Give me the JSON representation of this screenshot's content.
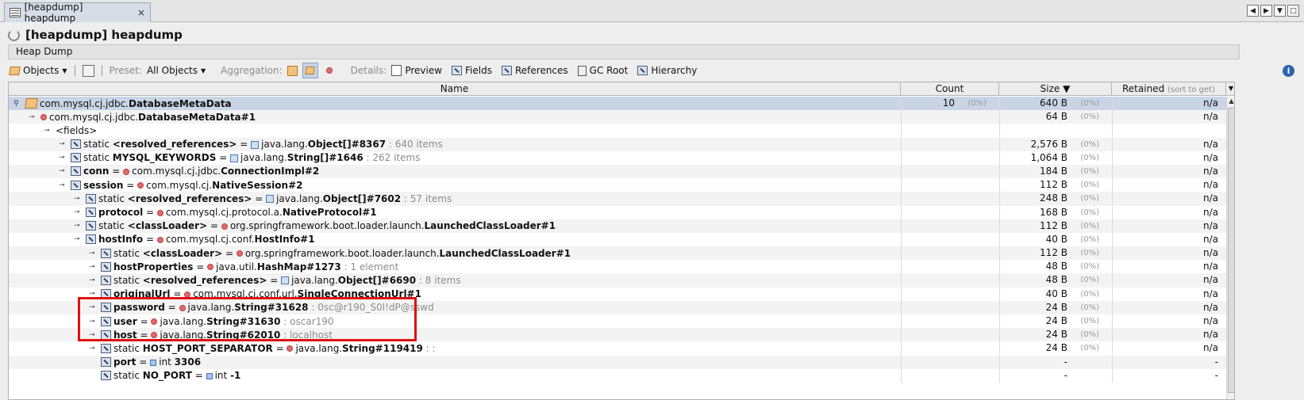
{
  "tab": {
    "label": "[heapdump] heapdump",
    "close": "×"
  },
  "window_buttons": [
    "◀",
    "▶",
    "▼",
    "□"
  ],
  "title": "[heapdump] heapdump",
  "section": "Heap Dump",
  "toolbar": {
    "objects": "Objects",
    "preset_label": "Preset:",
    "preset_value": "All Objects",
    "aggregation_label": "Aggregation:",
    "details_label": "Details:",
    "preview": "Preview",
    "fields": "Fields",
    "references": "References",
    "gc_root": "GC Root",
    "hierarchy": "Hierarchy"
  },
  "columns": {
    "name": "Name",
    "count": "Count",
    "size": "Size ▼",
    "retained": "Retained",
    "retained_note": "(sort to get)"
  },
  "rows": [
    {
      "depth": 0,
      "toggle": "⚲",
      "icon": "class",
      "static": "",
      "name": "",
      "eq": "",
      "pkg": "com.mysql.cj.jdbc.",
      "cls": "DatabaseMetaData",
      "suffix": "",
      "count": "10",
      "countpct": "(0%)",
      "size": "640 B",
      "sizepct": "(0%)",
      "ret": "n/a",
      "sel": true
    },
    {
      "depth": 1,
      "toggle": "⊸",
      "icon": "obj",
      "static": "",
      "name": "",
      "eq": "",
      "pkg": "com.mysql.cj.jdbc.",
      "cls": "DatabaseMetaData#1",
      "suffix": "",
      "count": "",
      "countpct": "",
      "size": "64 B",
      "sizepct": "(0%)",
      "ret": "n/a"
    },
    {
      "depth": 2,
      "toggle": "⊸",
      "icon": "none",
      "static": "",
      "name": "",
      "eq": "",
      "pkg": "<fields>",
      "cls": "",
      "suffix": "",
      "count": "",
      "countpct": "",
      "size": "",
      "sizepct": "",
      "ret": ""
    },
    {
      "depth": 3,
      "toggle": "⊸",
      "icon": "field",
      "static": "static ",
      "name": "<resolved_references>",
      "eq": " = ",
      "vicon": "arr",
      "pkg": "java.lang.",
      "cls": "Object[]#8367",
      "suffix": " : 640 items",
      "count": "",
      "countpct": "",
      "size": "2,576 B",
      "sizepct": "(0%)",
      "ret": "n/a"
    },
    {
      "depth": 3,
      "toggle": "⊸",
      "icon": "field",
      "static": "static ",
      "name": "MYSQL_KEYWORDS",
      "eq": " = ",
      "vicon": "arr",
      "pkg": "java.lang.",
      "cls": "String[]#1646",
      "suffix": " : 262 items",
      "count": "",
      "countpct": "",
      "size": "1,064 B",
      "sizepct": "(0%)",
      "ret": "n/a"
    },
    {
      "depth": 3,
      "toggle": "⊸",
      "icon": "field",
      "static": "",
      "name": "conn",
      "eq": " = ",
      "vicon": "obj",
      "pkg": "com.mysql.cj.jdbc.",
      "cls": "ConnectionImpl#2",
      "suffix": "",
      "count": "",
      "countpct": "",
      "size": "184 B",
      "sizepct": "(0%)",
      "ret": "n/a"
    },
    {
      "depth": 3,
      "toggle": "⊸",
      "icon": "field",
      "static": "",
      "name": "session",
      "eq": " = ",
      "vicon": "obj",
      "pkg": "com.mysql.cj.",
      "cls": "NativeSession#2",
      "suffix": "",
      "count": "",
      "countpct": "",
      "size": "112 B",
      "sizepct": "(0%)",
      "ret": "n/a"
    },
    {
      "depth": 4,
      "toggle": "⊸",
      "icon": "field",
      "static": "static ",
      "name": "<resolved_references>",
      "eq": " = ",
      "vicon": "arr",
      "pkg": "java.lang.",
      "cls": "Object[]#7602",
      "suffix": " : 57 items",
      "count": "",
      "countpct": "",
      "size": "248 B",
      "sizepct": "(0%)",
      "ret": "n/a"
    },
    {
      "depth": 4,
      "toggle": "⊸",
      "icon": "field",
      "static": "",
      "name": "protocol",
      "eq": " = ",
      "vicon": "obj",
      "pkg": "com.mysql.cj.protocol.a.",
      "cls": "NativeProtocol#1",
      "suffix": "",
      "count": "",
      "countpct": "",
      "size": "168 B",
      "sizepct": "(0%)",
      "ret": "n/a"
    },
    {
      "depth": 4,
      "toggle": "⊸",
      "icon": "field",
      "static": "static ",
      "name": "<classLoader>",
      "eq": " = ",
      "vicon": "obj",
      "pkg": "org.springframework.boot.loader.launch.",
      "cls": "LaunchedClassLoader#1",
      "suffix": "",
      "count": "",
      "countpct": "",
      "size": "112 B",
      "sizepct": "(0%)",
      "ret": "n/a"
    },
    {
      "depth": 4,
      "toggle": "⊸",
      "icon": "field",
      "static": "",
      "name": "hostInfo",
      "eq": " = ",
      "vicon": "obj",
      "pkg": "com.mysql.cj.conf.",
      "cls": "HostInfo#1",
      "suffix": "",
      "count": "",
      "countpct": "",
      "size": "40 B",
      "sizepct": "(0%)",
      "ret": "n/a"
    },
    {
      "depth": 5,
      "toggle": "⊸",
      "icon": "field",
      "static": "static ",
      "name": "<classLoader>",
      "eq": " = ",
      "vicon": "obj",
      "pkg": "org.springframework.boot.loader.launch.",
      "cls": "LaunchedClassLoader#1",
      "suffix": "",
      "count": "",
      "countpct": "",
      "size": "112 B",
      "sizepct": "(0%)",
      "ret": "n/a"
    },
    {
      "depth": 5,
      "toggle": "⊸",
      "icon": "field",
      "static": "",
      "name": "hostProperties",
      "eq": " = ",
      "vicon": "obj",
      "pkg": "java.util.",
      "cls": "HashMap#1273",
      "suffix": " : 1 element",
      "count": "",
      "countpct": "",
      "size": "48 B",
      "sizepct": "(0%)",
      "ret": "n/a"
    },
    {
      "depth": 5,
      "toggle": "⊸",
      "icon": "field",
      "static": "static ",
      "name": "<resolved_references>",
      "eq": " = ",
      "vicon": "arr",
      "pkg": "java.lang.",
      "cls": "Object[]#6690",
      "suffix": " : 8 items",
      "count": "",
      "countpct": "",
      "size": "48 B",
      "sizepct": "(0%)",
      "ret": "n/a"
    },
    {
      "depth": 5,
      "toggle": "⊸",
      "icon": "field",
      "static": "",
      "name": "originalUrl",
      "eq": " = ",
      "vicon": "obj",
      "pkg": "com.mysql.cj.conf.url.",
      "cls": "SingleConnectionUrl#1",
      "suffix": "",
      "count": "",
      "countpct": "",
      "size": "40 B",
      "sizepct": "(0%)",
      "ret": "n/a"
    },
    {
      "depth": 5,
      "toggle": "⊸",
      "icon": "field",
      "static": "",
      "name": "password",
      "eq": " = ",
      "vicon": "obj",
      "pkg": "java.lang.",
      "cls": "String#31628",
      "suffix": " : 0sc@r190_S0l!dP@sswd",
      "count": "",
      "countpct": "",
      "size": "24 B",
      "sizepct": "(0%)",
      "ret": "n/a"
    },
    {
      "depth": 5,
      "toggle": "⊸",
      "icon": "field",
      "static": "",
      "name": "user",
      "eq": " = ",
      "vicon": "obj",
      "pkg": "java.lang.",
      "cls": "String#31630",
      "suffix": " : oscar190",
      "count": "",
      "countpct": "",
      "size": "24 B",
      "sizepct": "(0%)",
      "ret": "n/a"
    },
    {
      "depth": 5,
      "toggle": "⊸",
      "icon": "field",
      "static": "",
      "name": "host",
      "eq": " = ",
      "vicon": "obj",
      "pkg": "java.lang.",
      "cls": "String#62010",
      "suffix": " : localhost",
      "count": "",
      "countpct": "",
      "size": "24 B",
      "sizepct": "(0%)",
      "ret": "n/a"
    },
    {
      "depth": 5,
      "toggle": "⊸",
      "icon": "field",
      "static": "static ",
      "name": "HOST_PORT_SEPARATOR",
      "eq": " = ",
      "vicon": "obj",
      "pkg": "java.lang.",
      "cls": "String#119419",
      "suffix": " : :",
      "count": "",
      "countpct": "",
      "size": "24 B",
      "sizepct": "(0%)",
      "ret": "n/a"
    },
    {
      "depth": 5,
      "toggle": "",
      "icon": "field",
      "static": "",
      "name": "port",
      "eq": " = ",
      "vicon": "prim",
      "pkg": "int ",
      "cls": "3306",
      "suffix": "",
      "count": "",
      "countpct": "",
      "size": "-",
      "sizepct": "",
      "ret": "-"
    },
    {
      "depth": 5,
      "toggle": "",
      "icon": "field",
      "static": "static ",
      "name": "NO_PORT",
      "eq": " = ",
      "vicon": "prim",
      "pkg": "int ",
      "cls": "-1",
      "suffix": "",
      "count": "",
      "countpct": "",
      "size": "-",
      "sizepct": "",
      "ret": "-"
    }
  ]
}
